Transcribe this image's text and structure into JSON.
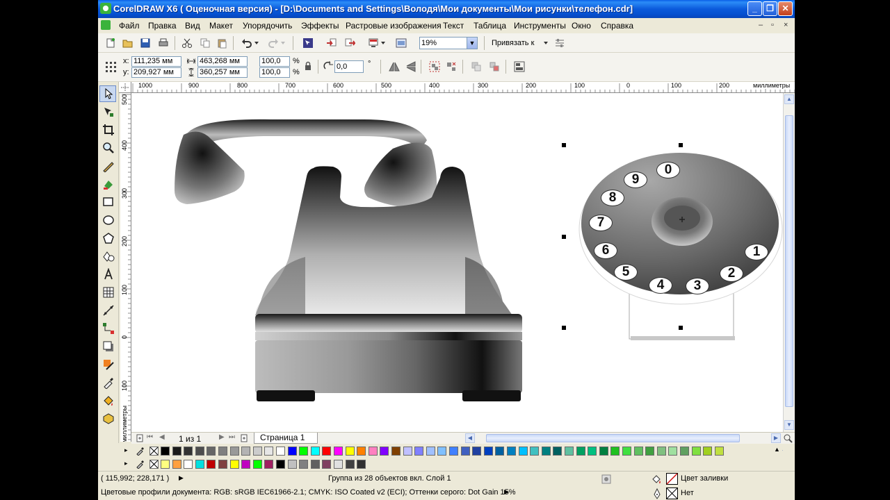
{
  "window": {
    "title": "CorelDRAW X6 ( Оценочная версия) - [D:\\Documents and Settings\\Володя\\Мои документы\\Мои рисунки\\телефон.cdr]",
    "controls": [
      "_",
      "❐",
      "✕"
    ]
  },
  "menu": {
    "items": [
      "Файл",
      "Правка",
      "Вид",
      "Макет",
      "Упорядочить",
      "Эффекты",
      "Растровые изображения",
      "Текст",
      "Таблица",
      "Инструменты",
      "Окно",
      "Справка"
    ],
    "mdi_controls": [
      "–",
      "▫",
      "×"
    ]
  },
  "standard_toolbar": {
    "zoom": "19%",
    "snap_label": "Привязать к"
  },
  "property_bar": {
    "x_label": "x:",
    "x_value": "111,235 мм",
    "y_label": "y:",
    "y_value": "209,927 мм",
    "width_value": "463,268 мм",
    "height_value": "360,257 мм",
    "scale_x": "100,0",
    "scale_y": "100,0",
    "percent": "%",
    "rotation": "0,0",
    "degree": "°"
  },
  "rulers": {
    "h_ticks": [
      "1000",
      "900",
      "800",
      "700",
      "600",
      "500",
      "400",
      "300",
      "200",
      "100",
      "0",
      "100",
      "200"
    ],
    "h_unit": "миллиметры",
    "v_ticks": [
      "500",
      "400",
      "300",
      "200",
      "100",
      "0",
      "100"
    ],
    "v_unit": "миллиметры"
  },
  "drawing": {
    "dial_numbers": [
      "0",
      "9",
      "8",
      "7",
      "6",
      "5",
      "4",
      "3",
      "2",
      "1"
    ]
  },
  "page_nav": {
    "counter": "1 из 1",
    "tab": "Страница 1"
  },
  "palette": {
    "row1": [
      "#000000",
      "#1A1A1A",
      "#333333",
      "#4D4D4D",
      "#666666",
      "#808080",
      "#999999",
      "#B3B3B3",
      "#CCCCCC",
      "#E6E6E6",
      "#FFFFFF",
      "#0000FF",
      "#00FF00",
      "#00FFFF",
      "#FF0000",
      "#FF00FF",
      "#FFFF00",
      "#FF8000",
      "#FF80C0",
      "#8000FF",
      "#804000",
      "#C0C0FF",
      "#8080FF",
      "#A0C0FF",
      "#80C0FF",
      "#4080FF",
      "#4060C0",
      "#2040A0",
      "#0040C0",
      "#0060A0",
      "#0080C0",
      "#00C0FF",
      "#40C0C0",
      "#008080",
      "#006060",
      "#60C0A0",
      "#00A060",
      "#00C080",
      "#008040",
      "#20C020",
      "#40E040",
      "#60C060",
      "#40A040",
      "#80C080",
      "#A0E0A0",
      "#60A060",
      "#80E040",
      "#A0D020",
      "#C0E040"
    ],
    "row2": [
      "#FFFF80",
      "#FFA040",
      "#FFFFFF",
      "#00E0E0",
      "#C00000",
      "#804040",
      "#FFFF00",
      "#C000C0",
      "#00FF00",
      "#A02060",
      "#000000",
      "#C0C0C0",
      "#808080",
      "#606060",
      "#804060",
      "#E0E0E0",
      "#404040",
      "#303030"
    ]
  },
  "status": {
    "coords": "( 115,992; 228,171 )",
    "selection": "Группа из 28 объектов вкл. Слой 1",
    "profiles": "Цветовые профили документа: RGB: sRGB IEC61966-2.1; CMYK: ISO Coated v2 (ECI); Оттенки серого: Dot Gain 15%",
    "fill_label": "Цвет заливки",
    "outline_label": "Нет"
  }
}
